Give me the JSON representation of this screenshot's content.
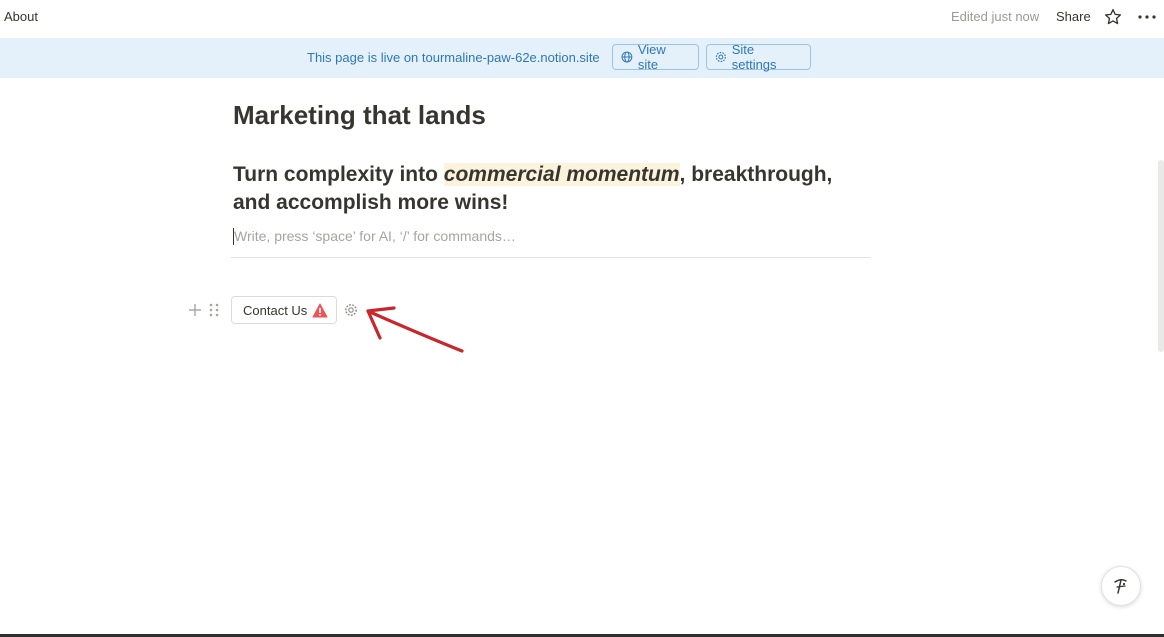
{
  "topbar": {
    "breadcrumb": "About",
    "edited": "Edited just now",
    "share_label": "Share",
    "favorite_icon": "star-icon",
    "more_icon": "more-dots-icon"
  },
  "banner": {
    "text": "This page is live on tourmaline-paw-62e.notion.site",
    "view_site_label": "View site",
    "site_settings_label": "Site settings",
    "color": "#e5f1fa",
    "accent": "#2f77b5"
  },
  "page": {
    "title": "Marketing that lands",
    "heading_before": "Turn complexity into ",
    "heading_highlight": "commercial momentum",
    "heading_after": ", breakthrough, and accomplish more wins!",
    "placeholder": "Write, press ‘space’ for AI, ‘/’ for commands…"
  },
  "block": {
    "button_label": "Contact Us",
    "warning_icon": "warning-triangle-icon",
    "warning_color": "#eb5757",
    "settings_icon": "gear-icon",
    "annotation_color": "#c8262c"
  },
  "help": {
    "icon": "help-assistant-icon"
  }
}
